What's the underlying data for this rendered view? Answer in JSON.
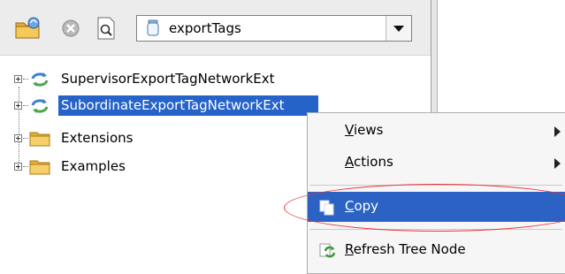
{
  "toolbar": {
    "combo_value": "exportTags",
    "icons": [
      "folder-sync-icon",
      "stop-icon",
      "search-doc-icon",
      "jar-icon",
      "dropdown-arrow-icon"
    ]
  },
  "tree": {
    "nodes": [
      {
        "label": "SupervisorExportTagNetworkExt",
        "icon": "sync-arrows-icon",
        "selected": false
      },
      {
        "label": "SubordinateExportTagNetworkExt",
        "icon": "sync-arrows-icon",
        "selected": true
      },
      {
        "label": "Extensions",
        "icon": "folder-icon",
        "selected": false
      },
      {
        "label": "Examples",
        "icon": "folder-icon",
        "selected": false
      }
    ]
  },
  "context_menu": {
    "items": [
      {
        "mnemonic": "V",
        "rest": "iews",
        "has_submenu": true
      },
      {
        "mnemonic": "A",
        "rest": "ctions",
        "has_submenu": true
      },
      {
        "mnemonic": "C",
        "rest": "opy",
        "has_submenu": false,
        "highlighted": true,
        "icon": "copy-icon"
      },
      {
        "mnemonic": "R",
        "rest": "efresh Tree Node",
        "has_submenu": false,
        "icon": "refresh-icon"
      }
    ]
  },
  "colors": {
    "selection": "#2563c8",
    "menu_highlight": "#2b62c4",
    "callout": "#e5363a"
  }
}
